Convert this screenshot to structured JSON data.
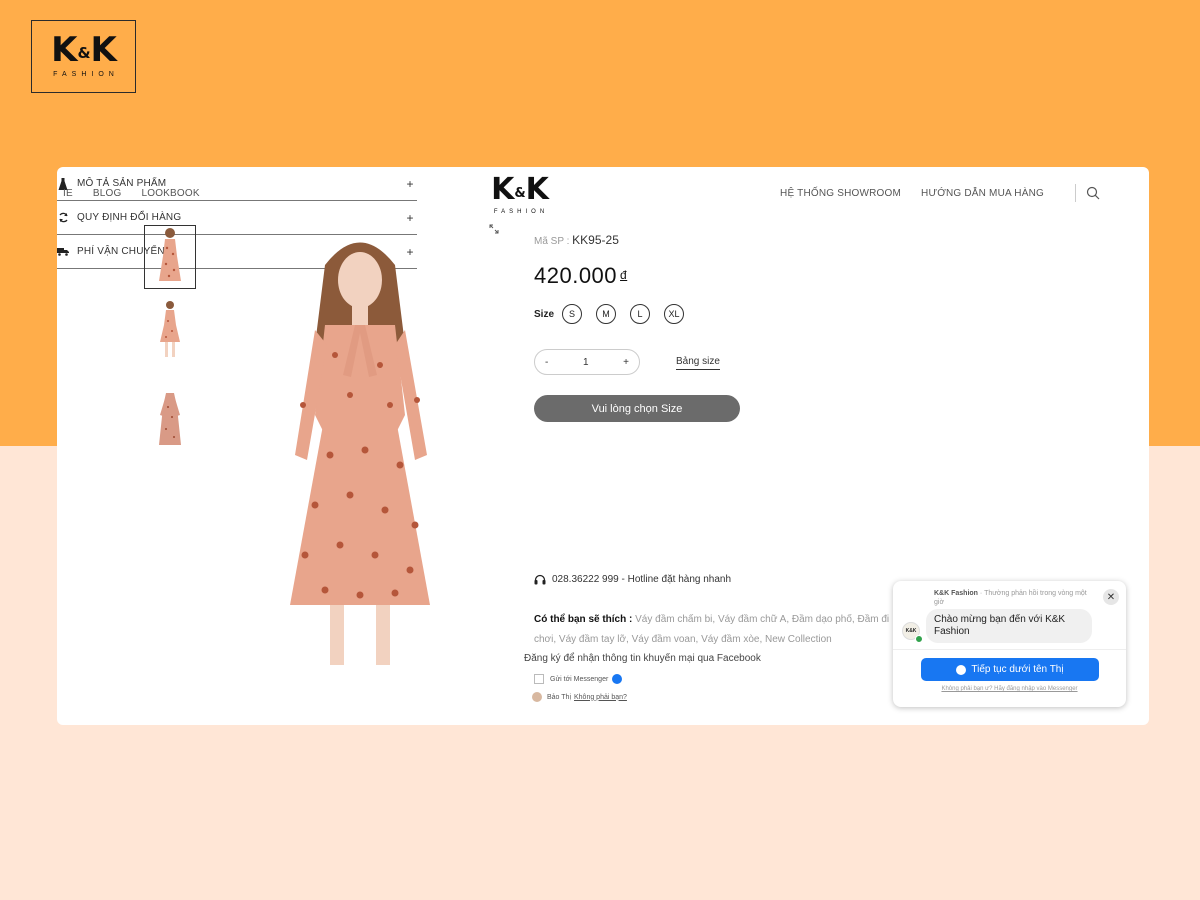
{
  "brand": {
    "name": "K&K",
    "tagline": "FASHION"
  },
  "nav": {
    "left": [
      "IE",
      "BLOG",
      "LOOKBOOK"
    ],
    "right": [
      "HỆ THỐNG SHOWROOM",
      "HƯỚNG DẪN MUA HÀNG"
    ]
  },
  "product": {
    "sku_label": "Mã SP :",
    "sku": "KK95-25",
    "price": "420.000",
    "currency": "đ",
    "size_label": "Size",
    "sizes": [
      "S",
      "M",
      "L",
      "XL"
    ],
    "qty_minus": "-",
    "qty": "1",
    "qty_plus": "+",
    "size_chart": "Bảng size",
    "cta": "Vui lòng chọn Size"
  },
  "accordion": [
    {
      "label": "MÔ TẢ SẢN PHẨM",
      "icon": "dress-icon"
    },
    {
      "label": "QUY ĐỊNH ĐỔI HÀNG",
      "icon": "refresh-icon"
    },
    {
      "label": "PHÍ VẬN CHUYỂN",
      "icon": "truck-icon"
    }
  ],
  "hotline": "028.36222 999 - Hotline đặt hàng nhanh",
  "suggest": {
    "label": "Có thể bạn sẽ thích :",
    "links": "Váy đầm chấm bi, Váy đầm chữ A, Đầm dạo phố, Đầm đi chơi, Váy đầm tay lỡ, Váy đầm voan, Váy đầm xòe, New Collection"
  },
  "facebook": {
    "note": "Đăng ký để nhận thông tin khuyến mại qua Facebook",
    "send": "Gửi tới Messenger",
    "user": "Bảo Thị",
    "not_you": "Không phải bạn?"
  },
  "chat": {
    "page": "K&K Fashion",
    "status": "Thường phản hồi trong vòng một giờ",
    "message": "Chào mừng bạn đến với K&K Fashion",
    "button": "Tiếp tục dưới tên Thị",
    "footer": "Không phải bạn ư? Hãy đăng nhập vào Messenger",
    "avatar": "K&K",
    "close": "✕"
  },
  "colors": {
    "orange": "#ffad4a",
    "peach": "#ffe6d6",
    "messenger": "#1877f2",
    "cta": "#6b6b6b"
  }
}
